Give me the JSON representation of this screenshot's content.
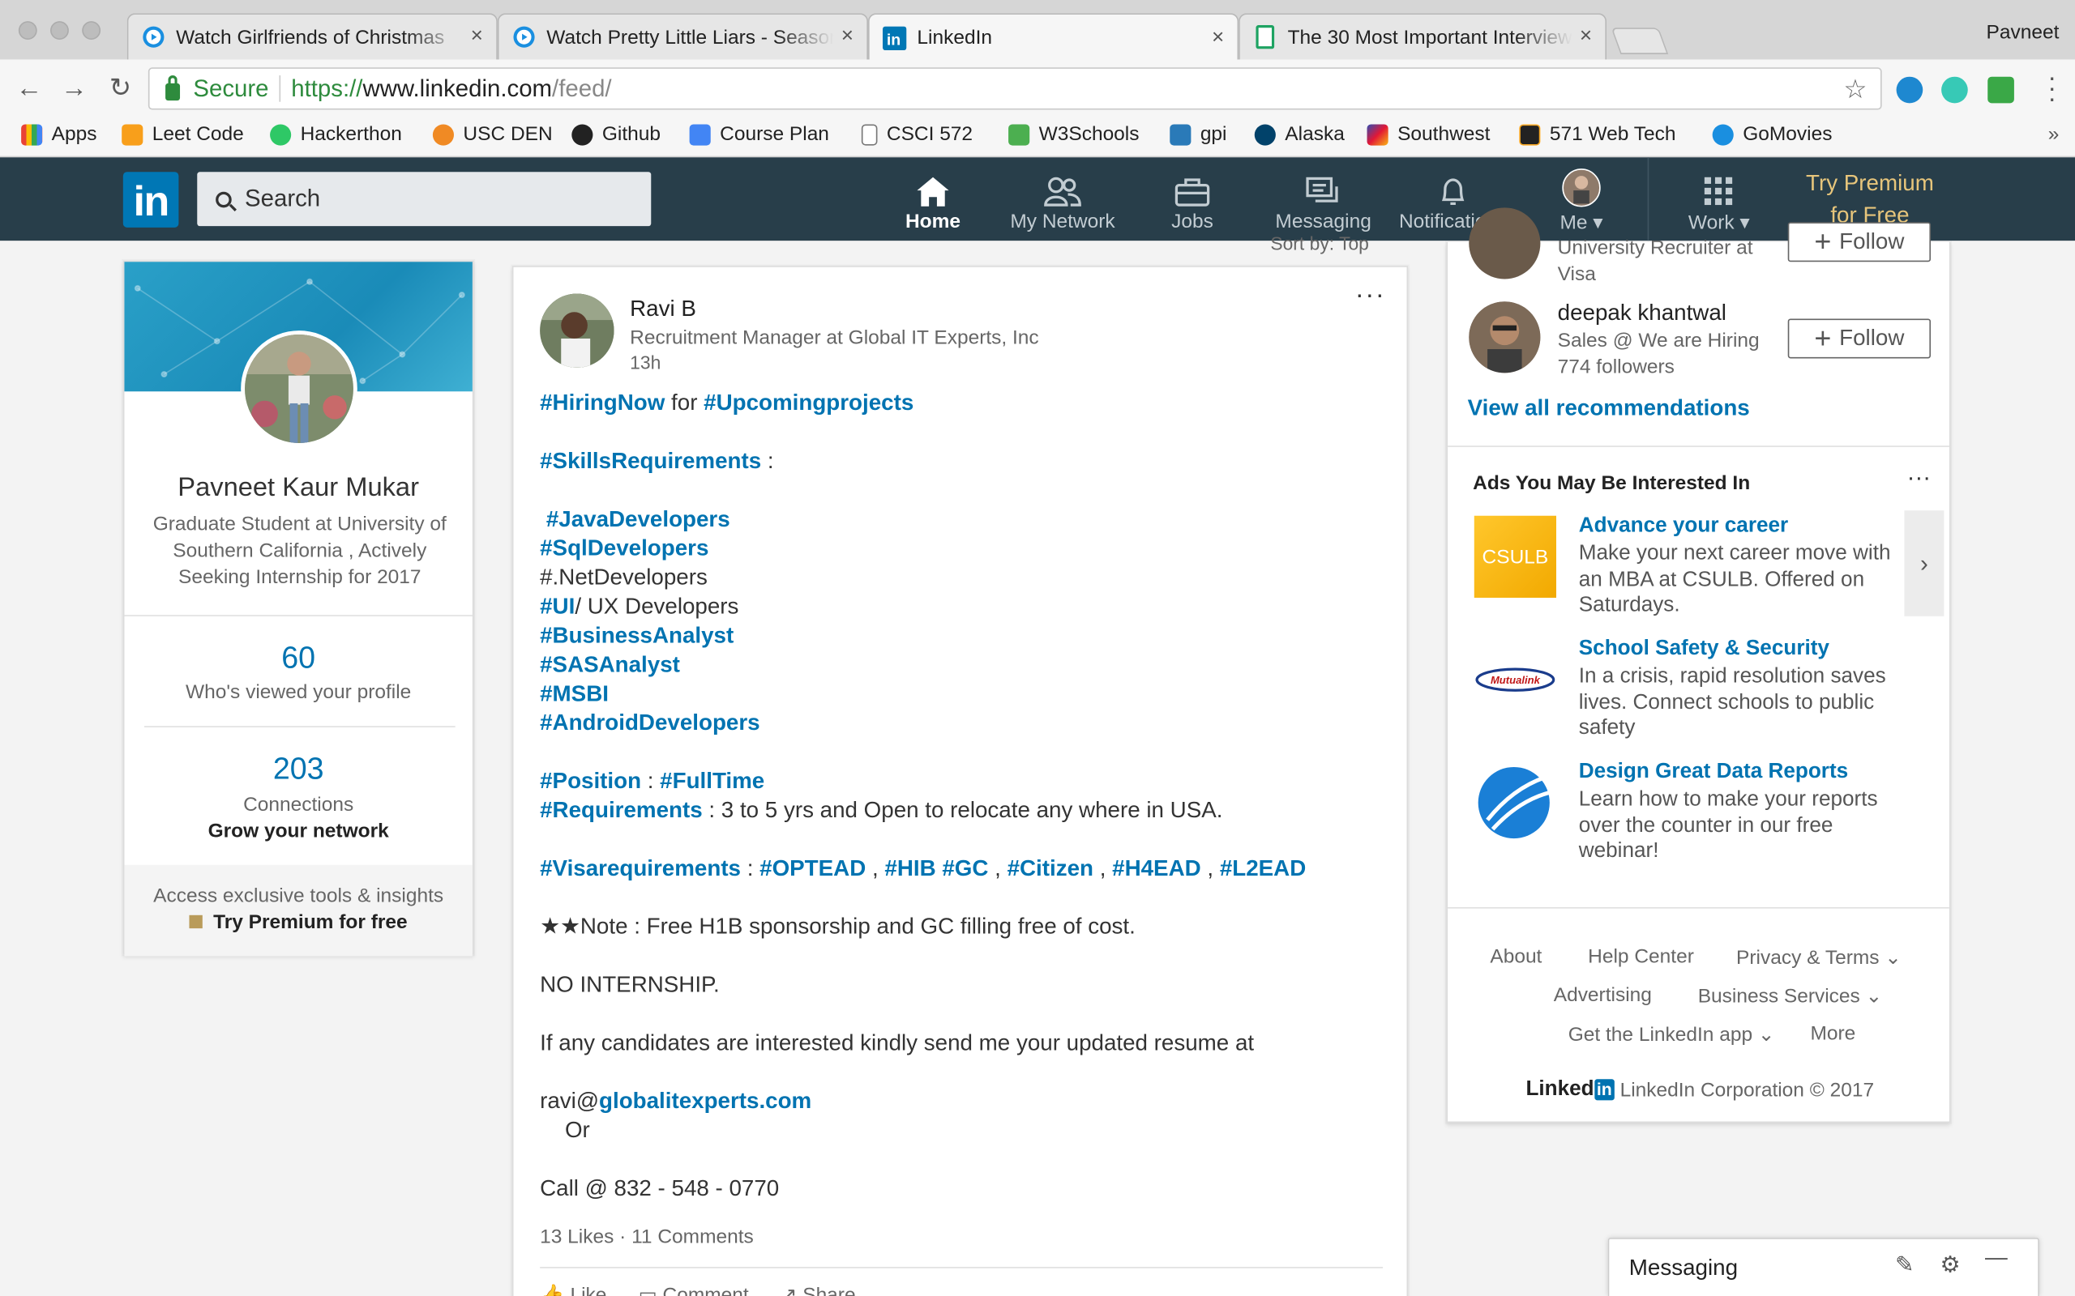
{
  "browser": {
    "tabs": [
      {
        "title": "Watch Girlfriends of Christmas",
        "close": "×",
        "icon": "play-circle-icon"
      },
      {
        "title": "Watch Pretty Little Liars - Season",
        "close": "×",
        "icon": "play-circle-icon"
      },
      {
        "title": "LinkedIn",
        "close": "×",
        "icon": "linkedin-icon"
      },
      {
        "title": "The 30 Most Important Interview",
        "close": "×",
        "icon": "sheet-icon"
      }
    ],
    "profile_name": "Pavneet",
    "secure_label": "Secure",
    "url_scheme": "https://",
    "url_host": "www.linkedin.com",
    "url_path": "/feed/",
    "bookmarks": [
      "Apps",
      "Leet Code",
      "Hackerthon",
      "USC DEN",
      "Github",
      "Course Plan",
      "CSCI 572",
      "W3Schools",
      "gpi",
      "Alaska",
      "Southwest",
      "571 Web Tech",
      "GoMovies"
    ],
    "bookmarks_more": "»"
  },
  "linkedin_nav": {
    "logo": "in",
    "search_placeholder": "Search",
    "items": [
      "Home",
      "My Network",
      "Jobs",
      "Messaging",
      "Notifications",
      "Me",
      "Work"
    ],
    "premium_line1": "Try Premium",
    "premium_line2": "for Free"
  },
  "profile": {
    "name": "Pavneet Kaur Mukar",
    "headline": "Graduate Student at University of Southern California , Actively Seeking Internship for 2017",
    "views_count": "60",
    "views_label": "Who's viewed your profile",
    "connections_count": "203",
    "connections_label": "Connections",
    "grow_label": "Grow your network",
    "premium_teaser": "Access exclusive tools & insights",
    "premium_cta": "Try Premium for free"
  },
  "feed": {
    "sort_label": "Sort by: Top",
    "post": {
      "author": "Ravi B",
      "headline": "Recruitment Manager at Global IT Experts, Inc",
      "time": "13h",
      "menu": "···",
      "lines": [
        {
          "segments": [
            {
              "t": "#HiringNow",
              "tag": true
            },
            {
              "t": " for ",
              "tag": false
            },
            {
              "t": "#Upcomingprojects",
              "tag": true
            }
          ]
        },
        {
          "gap": true
        },
        {
          "segments": [
            {
              "t": "#SkillsRequirements",
              "tag": true
            },
            {
              "t": " :",
              "tag": false
            }
          ]
        },
        {
          "gap": true
        },
        {
          "segments": [
            {
              "t": " #JavaDevelopers",
              "tag": true
            }
          ]
        },
        {
          "segments": [
            {
              "t": "#SqlDevelopers",
              "tag": true
            }
          ]
        },
        {
          "segments": [
            {
              "t": "#.NetDevelopers",
              "tag": false
            }
          ]
        },
        {
          "segments": [
            {
              "t": "#UI",
              "tag": true
            },
            {
              "t": "/ UX Developers",
              "tag": false
            }
          ]
        },
        {
          "segments": [
            {
              "t": "#BusinessAnalyst",
              "tag": true
            }
          ]
        },
        {
          "segments": [
            {
              "t": "#SASAnalyst",
              "tag": true
            }
          ]
        },
        {
          "segments": [
            {
              "t": "#MSBI",
              "tag": true
            }
          ]
        },
        {
          "segments": [
            {
              "t": "#AndroidDevelopers",
              "tag": true
            }
          ]
        },
        {
          "gap": true
        },
        {
          "segments": [
            {
              "t": "#Position",
              "tag": true
            },
            {
              "t": " : ",
              "tag": false
            },
            {
              "t": "#FullTime",
              "tag": true
            }
          ]
        },
        {
          "segments": [
            {
              "t": "#Requirements",
              "tag": true
            },
            {
              "t": " : 3 to 5 yrs and Open to relocate any where in USA.",
              "tag": false
            }
          ]
        },
        {
          "gap": true
        },
        {
          "segments": [
            {
              "t": "#Visarequirements",
              "tag": true
            },
            {
              "t": " : ",
              "tag": false
            },
            {
              "t": "#OPTEAD",
              "tag": true
            },
            {
              "t": " , ",
              "tag": false
            },
            {
              "t": "#HIB",
              "tag": true
            },
            {
              "t": " ",
              "tag": false
            },
            {
              "t": "#GC",
              "tag": true
            },
            {
              "t": " , ",
              "tag": false
            },
            {
              "t": "#Citizen",
              "tag": true
            },
            {
              "t": " , ",
              "tag": false
            },
            {
              "t": "#H4EAD",
              "tag": true
            },
            {
              "t": " , ",
              "tag": false
            },
            {
              "t": "#L2EAD",
              "tag": true
            }
          ]
        },
        {
          "gap": true
        },
        {
          "segments": [
            {
              "t": "★★Note : Free H1B sponsorship and GC filling free of cost.",
              "tag": false
            }
          ]
        },
        {
          "gap": true
        },
        {
          "segments": [
            {
              "t": "NO INTERNSHIP.",
              "tag": false
            }
          ]
        },
        {
          "gap": true
        },
        {
          "segments": [
            {
              "t": "If any candidates are interested kindly send me your updated resume at",
              "tag": false
            }
          ]
        },
        {
          "gap": true
        },
        {
          "segments": [
            {
              "t": "ravi@",
              "tag": false
            },
            {
              "t": "globalitexperts.com",
              "tag": true
            }
          ]
        },
        {
          "segments": [
            {
              "t": "    Or",
              "tag": false
            }
          ]
        },
        {
          "gap": true
        },
        {
          "segments": [
            {
              "t": "Call @ 832 - 548 - 0770",
              "tag": false
            }
          ]
        }
      ],
      "likes": "13 Likes",
      "comments": "11 Comments",
      "actions": [
        "Like",
        "Comment",
        "Share"
      ]
    }
  },
  "rail": {
    "recs": [
      {
        "name": "",
        "sub1": "University Recruiter at",
        "sub2": "Visa",
        "follow": "Follow"
      },
      {
        "name": "deepak khantwal",
        "sub1": "Sales @ We are Hiring",
        "sub2": "774 followers",
        "follow": "Follow"
      }
    ],
    "view_all": "View all recommendations",
    "ads_title": "Ads You May Be Interested In",
    "ads_menu": "···",
    "ads": [
      {
        "logo": "CSULB",
        "title": "Advance your career",
        "text": "Make your next career move with an MBA at CSULB. Offered on Saturdays."
      },
      {
        "logo": "Mutualink",
        "title": "School Safety & Security",
        "text": "In a crisis, rapid resolution saves lives. Connect schools to public safety"
      },
      {
        "logo": "",
        "title": "Design Great Data Reports",
        "text": "Learn how to make your reports over the counter in our free webinar!"
      }
    ],
    "ad_next": "›",
    "footer_links": [
      "About",
      "Help Center",
      "Privacy & Terms",
      "Advertising",
      "Business Services",
      "Get the LinkedIn app",
      "More"
    ],
    "footer_brand": "Linked",
    "footer_brand_in": "in",
    "footer_copyright": "LinkedIn Corporation © 2017"
  },
  "messaging": {
    "label": "Messaging"
  }
}
